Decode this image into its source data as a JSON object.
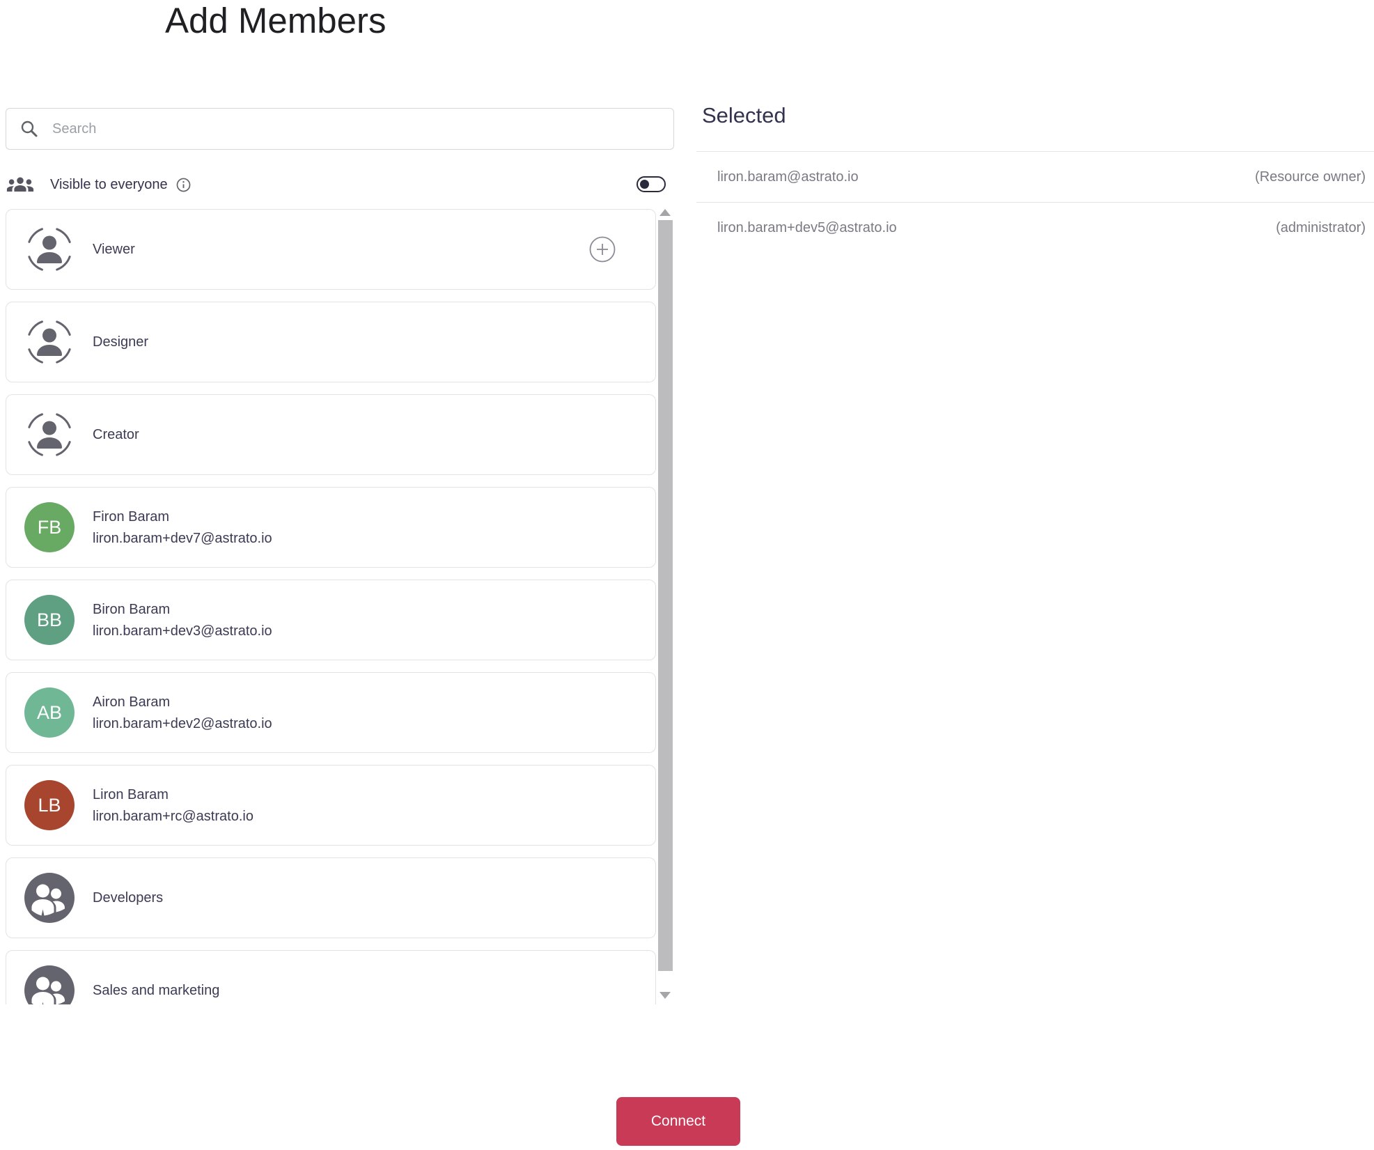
{
  "page": {
    "title": "Add Members"
  },
  "search": {
    "placeholder": "Search"
  },
  "visibility": {
    "label": "Visible to everyone",
    "enabled": false
  },
  "member_list": [
    {
      "type": "role",
      "label": "Viewer",
      "has_add_button": true
    },
    {
      "type": "role",
      "label": "Designer",
      "has_add_button": false
    },
    {
      "type": "role",
      "label": "Creator",
      "has_add_button": false
    },
    {
      "type": "user",
      "initials": "FB",
      "name": "Firon Baram",
      "email": "liron.baram+dev7@astrato.io",
      "avatar_color": "#68a963"
    },
    {
      "type": "user",
      "initials": "BB",
      "name": "Biron Baram",
      "email": "liron.baram+dev3@astrato.io",
      "avatar_color": "#5f9f82"
    },
    {
      "type": "user",
      "initials": "AB",
      "name": "Airon Baram",
      "email": "liron.baram+dev2@astrato.io",
      "avatar_color": "#70b795"
    },
    {
      "type": "user",
      "initials": "LB",
      "name": "Liron Baram",
      "email": "liron.baram+rc@astrato.io",
      "avatar_color": "#a8452f"
    },
    {
      "type": "group",
      "label": "Developers"
    },
    {
      "type": "group",
      "label": "Sales and marketing"
    }
  ],
  "selected_panel": {
    "title": "Selected",
    "rows": [
      {
        "email": "liron.baram@astrato.io",
        "role": "(Resource owner)"
      },
      {
        "email": "liron.baram+dev5@astrato.io",
        "role": "(administrator)"
      }
    ]
  },
  "footer": {
    "connect_label": "Connect"
  },
  "colors": {
    "accent": "#c93a56",
    "icon_gray": "#64646f",
    "toggle_dark": "#2a2a3d"
  }
}
